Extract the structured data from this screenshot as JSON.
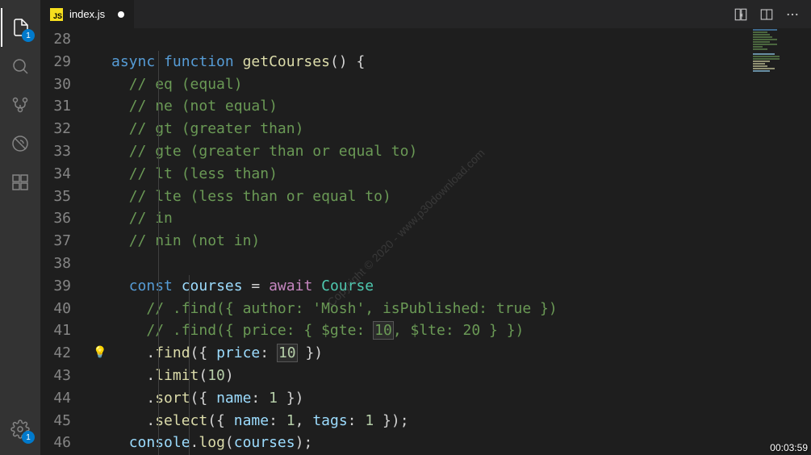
{
  "activityBar": {
    "explorerBadge": "1",
    "settingsBadge": "1"
  },
  "tabs": {
    "active": {
      "iconText": "JS",
      "label": "index.js",
      "dirty": true
    }
  },
  "editor": {
    "lines": [
      {
        "num": "28",
        "tokens": []
      },
      {
        "num": "29",
        "tokens": [
          {
            "t": "async ",
            "c": "kw"
          },
          {
            "t": "function ",
            "c": "kw"
          },
          {
            "t": "getCourses",
            "c": "fn"
          },
          {
            "t": "() {",
            "c": "punc"
          }
        ]
      },
      {
        "num": "30",
        "tokens": [
          {
            "t": "  ",
            "c": ""
          },
          {
            "t": "// eq (equal)",
            "c": "cm"
          }
        ]
      },
      {
        "num": "31",
        "tokens": [
          {
            "t": "  ",
            "c": ""
          },
          {
            "t": "// ne (not equal)",
            "c": "cm"
          }
        ]
      },
      {
        "num": "32",
        "tokens": [
          {
            "t": "  ",
            "c": ""
          },
          {
            "t": "// gt (greater than)",
            "c": "cm"
          }
        ]
      },
      {
        "num": "33",
        "tokens": [
          {
            "t": "  ",
            "c": ""
          },
          {
            "t": "// gte (greater than or equal to)",
            "c": "cm"
          }
        ]
      },
      {
        "num": "34",
        "tokens": [
          {
            "t": "  ",
            "c": ""
          },
          {
            "t": "// lt (less than)",
            "c": "cm"
          }
        ]
      },
      {
        "num": "35",
        "tokens": [
          {
            "t": "  ",
            "c": ""
          },
          {
            "t": "// lte (less than or equal to)",
            "c": "cm"
          }
        ]
      },
      {
        "num": "36",
        "tokens": [
          {
            "t": "  ",
            "c": ""
          },
          {
            "t": "// in",
            "c": "cm"
          }
        ]
      },
      {
        "num": "37",
        "tokens": [
          {
            "t": "  ",
            "c": ""
          },
          {
            "t": "// nin (not in)",
            "c": "cm"
          }
        ]
      },
      {
        "num": "38",
        "tokens": []
      },
      {
        "num": "39",
        "tokens": [
          {
            "t": "  ",
            "c": ""
          },
          {
            "t": "const ",
            "c": "kw"
          },
          {
            "t": "courses",
            "c": "var"
          },
          {
            "t": " = ",
            "c": "op"
          },
          {
            "t": "await ",
            "c": "kw2"
          },
          {
            "t": "Course",
            "c": "cls"
          }
        ]
      },
      {
        "num": "40",
        "tokens": [
          {
            "t": "    ",
            "c": ""
          },
          {
            "t": "// .find({ author: 'Mosh', isPublished: true })",
            "c": "cm"
          }
        ]
      },
      {
        "num": "41",
        "tokens": [
          {
            "t": "    ",
            "c": ""
          },
          {
            "t": "// .find({ price: { $gte: ",
            "c": "cm"
          },
          {
            "t": "10",
            "c": "cm hlbox"
          },
          {
            "t": ", $lte: 20 } })",
            "c": "cm"
          }
        ]
      },
      {
        "num": "42",
        "glyph": "bulb",
        "tokens": [
          {
            "t": "    .",
            "c": "punc"
          },
          {
            "t": "find",
            "c": "fn"
          },
          {
            "t": "({ ",
            "c": "punc"
          },
          {
            "t": "price",
            "c": "prop"
          },
          {
            "t": ": ",
            "c": "punc"
          },
          {
            "t": "10",
            "c": "num hlbox"
          },
          {
            "t": " })",
            "c": "punc"
          }
        ]
      },
      {
        "num": "43",
        "tokens": [
          {
            "t": "    .",
            "c": "punc"
          },
          {
            "t": "limit",
            "c": "fn"
          },
          {
            "t": "(",
            "c": "punc"
          },
          {
            "t": "10",
            "c": "num"
          },
          {
            "t": ")",
            "c": "punc"
          }
        ]
      },
      {
        "num": "44",
        "tokens": [
          {
            "t": "    .",
            "c": "punc"
          },
          {
            "t": "sort",
            "c": "fn"
          },
          {
            "t": "({ ",
            "c": "punc"
          },
          {
            "t": "name",
            "c": "prop"
          },
          {
            "t": ": ",
            "c": "punc"
          },
          {
            "t": "1",
            "c": "num"
          },
          {
            "t": " })",
            "c": "punc"
          }
        ]
      },
      {
        "num": "45",
        "tokens": [
          {
            "t": "    .",
            "c": "punc"
          },
          {
            "t": "select",
            "c": "fn"
          },
          {
            "t": "({ ",
            "c": "punc"
          },
          {
            "t": "name",
            "c": "prop"
          },
          {
            "t": ": ",
            "c": "punc"
          },
          {
            "t": "1",
            "c": "num"
          },
          {
            "t": ", ",
            "c": "punc"
          },
          {
            "t": "tags",
            "c": "prop"
          },
          {
            "t": ": ",
            "c": "punc"
          },
          {
            "t": "1",
            "c": "num"
          },
          {
            "t": " });",
            "c": "punc"
          }
        ]
      },
      {
        "num": "46",
        "tokens": [
          {
            "t": "  ",
            "c": ""
          },
          {
            "t": "console",
            "c": "var"
          },
          {
            "t": ".",
            "c": "punc"
          },
          {
            "t": "log",
            "c": "fn"
          },
          {
            "t": "(",
            "c": "punc"
          },
          {
            "t": "courses",
            "c": "var"
          },
          {
            "t": ");",
            "c": "punc"
          }
        ]
      }
    ]
  },
  "watermark": "Copyright © 2020 - www.p30download.com",
  "timestamp": "00:03:59"
}
